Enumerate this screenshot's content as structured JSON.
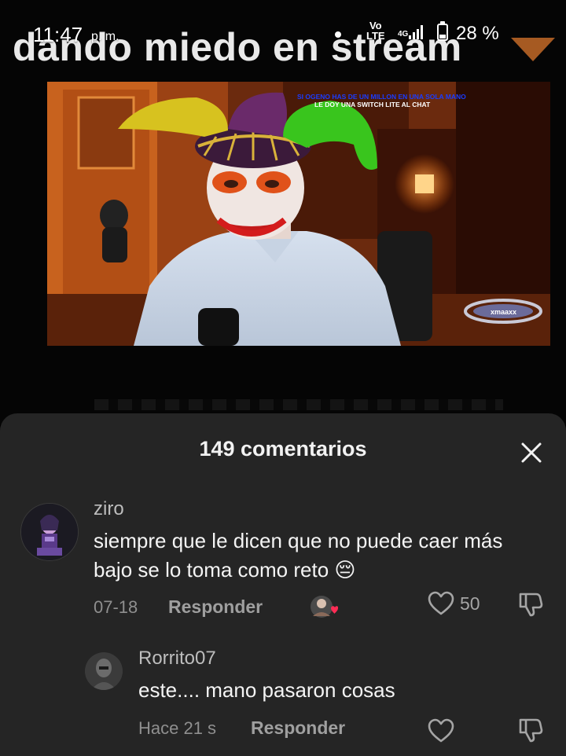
{
  "status_bar": {
    "time": "11:47",
    "ampm": "p. m.",
    "volte": "Vo\nLTE",
    "network": "4G",
    "battery": "28 %"
  },
  "video": {
    "caption": "dando miedo en stream",
    "overlay_line1": "SI OGENO HAS DE UN MILLON EN UNA SOLA MANO",
    "overlay_line2": "LE DOY UNA SWITCH LITE AL CHAT",
    "overlay_logo": "xmaaxx"
  },
  "comments_panel": {
    "title": "149 comentarios",
    "comments": [
      {
        "username": "ziro",
        "text": "siempre que le dicen que no puede caer más bajo se lo toma como reto 😔",
        "date": "07-18",
        "reply_label": "Responder",
        "likes": "50"
      },
      {
        "username": "Rorrito07",
        "text": "este.... mano pasaron cosas",
        "date": "Hace 21 s",
        "reply_label": "Responder",
        "likes": ""
      }
    ]
  },
  "colors": {
    "sheet_bg": "#252525",
    "muted_text": "#8f8f8f",
    "creator_heart": "#ff2c55"
  }
}
